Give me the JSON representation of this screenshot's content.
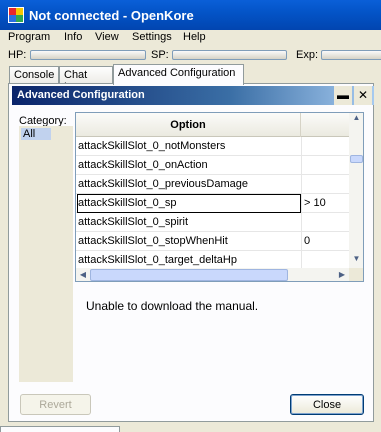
{
  "window": {
    "title": "Not connected - OpenKore",
    "icon": "openkore-app-icon"
  },
  "menu": [
    "Program",
    "Info",
    "View",
    "Settings",
    "Help"
  ],
  "stats": {
    "hp_label": "HP:",
    "sp_label": "SP:",
    "exp_label": "Exp:"
  },
  "tabs": [
    "Console",
    "Chat Log",
    "Advanced Configuration"
  ],
  "active_tab": "Advanced Configuration",
  "dialog": {
    "title": "Advanced Configuration",
    "minimize_icon": "restore-icon",
    "close_icon": "close-icon",
    "category_label": "Category:",
    "categories": [
      "All"
    ],
    "selected_category": "All",
    "grid": {
      "headers": {
        "option": "Option",
        "value": ""
      },
      "rows": [
        {
          "option": "attackSkillSlot_0_notMonsters",
          "value": ""
        },
        {
          "option": "attackSkillSlot_0_onAction",
          "value": ""
        },
        {
          "option": "attackSkillSlot_0_previousDamage",
          "value": ""
        },
        {
          "option": "attackSkillSlot_0_sp",
          "value": "> 10",
          "selected": true
        },
        {
          "option": "attackSkillSlot_0_spirit",
          "value": ""
        },
        {
          "option": "attackSkillSlot_0_stopWhenHit",
          "value": "0"
        },
        {
          "option": "attackSkillSlot_0_target_deltaHp",
          "value": ""
        }
      ]
    },
    "manual_message": "Unable to download the manual.",
    "revert_label": "Revert",
    "close_label": "Close"
  }
}
